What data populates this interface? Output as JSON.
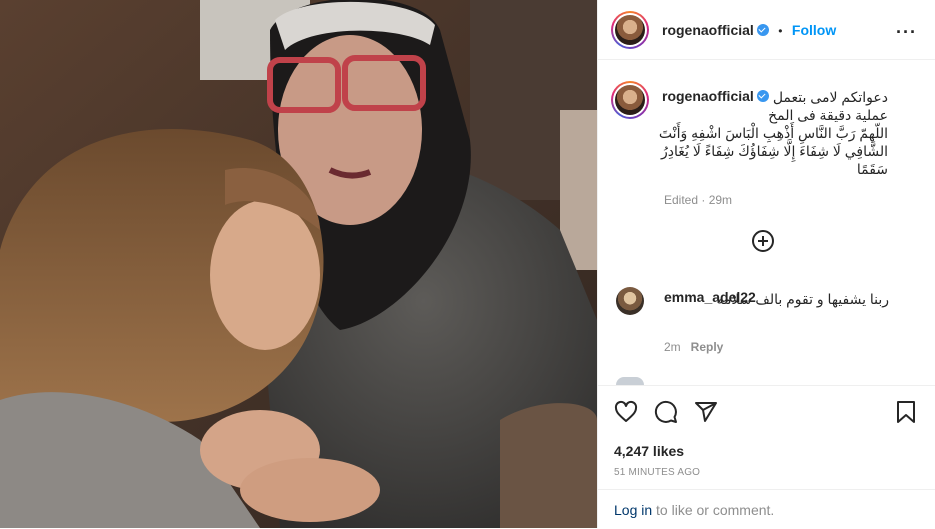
{
  "post": {
    "username": "rogenaofficial",
    "follow_label": "Follow",
    "dot": "•",
    "more_icon": "more-options-icon",
    "caption_username": "rogenaofficial",
    "caption_lines": [
      "دعواتكم لامى بتعمل",
      "عملية دقيقة فى المخ",
      "اللّهمّ رَبَّ النَّاسِ أَذْهِبِ الْبَاسَ اشْفِهِ وَأَنْتَ",
      "الشَّافِي لَا شِفَاءَ إِلَّا شِفَاؤُكَ شِفَاءً لَا يُغَادِرُ",
      "سَقَمًا"
    ],
    "edited": "Edited · 29m"
  },
  "comment": {
    "username": "emma_adel22",
    "text": "ربنا يشفيها و تقوم بالف سلامه",
    "age": "2m",
    "reply_label": "Reply"
  },
  "actions": {
    "icons": [
      "heart-icon",
      "comment-icon",
      "share-icon",
      "bookmark-icon"
    ],
    "likes": "4,247 likes",
    "posted": "51 MINUTES AGO"
  },
  "login": {
    "link": "Log in",
    "text": " to like or comment."
  },
  "colors": {
    "accent": "#0095f6",
    "text": "#262626",
    "muted": "#8e8e8e",
    "link_dark": "#00376b"
  }
}
